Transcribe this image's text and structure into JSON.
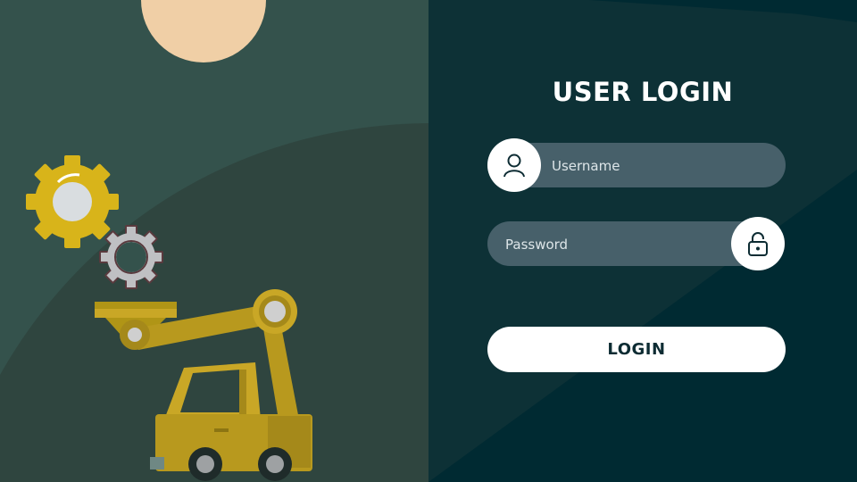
{
  "login": {
    "title": "USER LOGIN",
    "username_placeholder": "Username",
    "password_placeholder": "Password",
    "login_label": "LOGIN"
  },
  "icons": {
    "username": "user-icon",
    "password": "lock-icon"
  },
  "colors": {
    "left_background": "#34524c",
    "right_background": "#002a32",
    "field_background": "#47606a",
    "accent_yellow": "#c9a726",
    "sun": "#f0cfa6",
    "button": "#ffffff"
  }
}
